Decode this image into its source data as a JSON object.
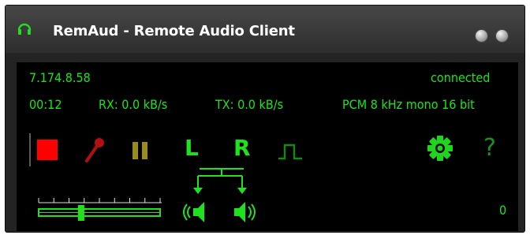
{
  "window": {
    "title": "RemAud - Remote Audio Client",
    "controls": [
      "minimize-button",
      "close-button"
    ]
  },
  "status": {
    "ip": "7.174.8.58",
    "connection": "connected",
    "time": "00:12",
    "rx": "RX: 0.0 kB/s",
    "tx": "TX: 0.0 kB/s",
    "format": "PCM 8 kHz mono 16 bit"
  },
  "toolbar": {
    "stop_icon": "stop-icon",
    "record_icon": "microphone-icon",
    "pause_icon": "pause-icon",
    "left_label": "L",
    "right_label": "R",
    "pulse_icon": "pulse-icon",
    "settings_icon": "gear-icon",
    "help_label": "?"
  },
  "volume": {
    "level": 0.35,
    "value_text": "0"
  },
  "colors": {
    "text": "#19e619",
    "stop": "#ff0000",
    "mic": "#b01010",
    "pause": "#9a8c1a",
    "accent": "#1fe21f",
    "pulse": "#108a10"
  }
}
